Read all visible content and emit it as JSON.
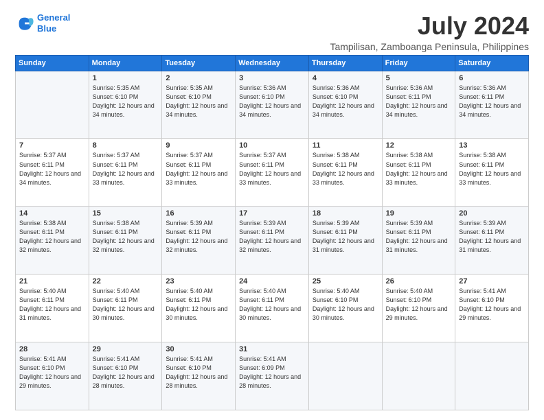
{
  "logo": {
    "line1": "General",
    "line2": "Blue"
  },
  "title": "July 2024",
  "location": "Tampilisan, Zamboanga Peninsula, Philippines",
  "days_of_week": [
    "Sunday",
    "Monday",
    "Tuesday",
    "Wednesday",
    "Thursday",
    "Friday",
    "Saturday"
  ],
  "weeks": [
    [
      {
        "day": "",
        "info": ""
      },
      {
        "day": "1",
        "info": "Sunrise: 5:35 AM\nSunset: 6:10 PM\nDaylight: 12 hours and 34 minutes."
      },
      {
        "day": "2",
        "info": "Sunrise: 5:35 AM\nSunset: 6:10 PM\nDaylight: 12 hours and 34 minutes."
      },
      {
        "day": "3",
        "info": "Sunrise: 5:36 AM\nSunset: 6:10 PM\nDaylight: 12 hours and 34 minutes."
      },
      {
        "day": "4",
        "info": "Sunrise: 5:36 AM\nSunset: 6:10 PM\nDaylight: 12 hours and 34 minutes."
      },
      {
        "day": "5",
        "info": "Sunrise: 5:36 AM\nSunset: 6:11 PM\nDaylight: 12 hours and 34 minutes."
      },
      {
        "day": "6",
        "info": "Sunrise: 5:36 AM\nSunset: 6:11 PM\nDaylight: 12 hours and 34 minutes."
      }
    ],
    [
      {
        "day": "7",
        "info": "Sunrise: 5:37 AM\nSunset: 6:11 PM\nDaylight: 12 hours and 34 minutes."
      },
      {
        "day": "8",
        "info": "Sunrise: 5:37 AM\nSunset: 6:11 PM\nDaylight: 12 hours and 33 minutes."
      },
      {
        "day": "9",
        "info": "Sunrise: 5:37 AM\nSunset: 6:11 PM\nDaylight: 12 hours and 33 minutes."
      },
      {
        "day": "10",
        "info": "Sunrise: 5:37 AM\nSunset: 6:11 PM\nDaylight: 12 hours and 33 minutes."
      },
      {
        "day": "11",
        "info": "Sunrise: 5:38 AM\nSunset: 6:11 PM\nDaylight: 12 hours and 33 minutes."
      },
      {
        "day": "12",
        "info": "Sunrise: 5:38 AM\nSunset: 6:11 PM\nDaylight: 12 hours and 33 minutes."
      },
      {
        "day": "13",
        "info": "Sunrise: 5:38 AM\nSunset: 6:11 PM\nDaylight: 12 hours and 33 minutes."
      }
    ],
    [
      {
        "day": "14",
        "info": "Sunrise: 5:38 AM\nSunset: 6:11 PM\nDaylight: 12 hours and 32 minutes."
      },
      {
        "day": "15",
        "info": "Sunrise: 5:38 AM\nSunset: 6:11 PM\nDaylight: 12 hours and 32 minutes."
      },
      {
        "day": "16",
        "info": "Sunrise: 5:39 AM\nSunset: 6:11 PM\nDaylight: 12 hours and 32 minutes."
      },
      {
        "day": "17",
        "info": "Sunrise: 5:39 AM\nSunset: 6:11 PM\nDaylight: 12 hours and 32 minutes."
      },
      {
        "day": "18",
        "info": "Sunrise: 5:39 AM\nSunset: 6:11 PM\nDaylight: 12 hours and 31 minutes."
      },
      {
        "day": "19",
        "info": "Sunrise: 5:39 AM\nSunset: 6:11 PM\nDaylight: 12 hours and 31 minutes."
      },
      {
        "day": "20",
        "info": "Sunrise: 5:39 AM\nSunset: 6:11 PM\nDaylight: 12 hours and 31 minutes."
      }
    ],
    [
      {
        "day": "21",
        "info": "Sunrise: 5:40 AM\nSunset: 6:11 PM\nDaylight: 12 hours and 31 minutes."
      },
      {
        "day": "22",
        "info": "Sunrise: 5:40 AM\nSunset: 6:11 PM\nDaylight: 12 hours and 30 minutes."
      },
      {
        "day": "23",
        "info": "Sunrise: 5:40 AM\nSunset: 6:11 PM\nDaylight: 12 hours and 30 minutes."
      },
      {
        "day": "24",
        "info": "Sunrise: 5:40 AM\nSunset: 6:11 PM\nDaylight: 12 hours and 30 minutes."
      },
      {
        "day": "25",
        "info": "Sunrise: 5:40 AM\nSunset: 6:10 PM\nDaylight: 12 hours and 30 minutes."
      },
      {
        "day": "26",
        "info": "Sunrise: 5:40 AM\nSunset: 6:10 PM\nDaylight: 12 hours and 29 minutes."
      },
      {
        "day": "27",
        "info": "Sunrise: 5:41 AM\nSunset: 6:10 PM\nDaylight: 12 hours and 29 minutes."
      }
    ],
    [
      {
        "day": "28",
        "info": "Sunrise: 5:41 AM\nSunset: 6:10 PM\nDaylight: 12 hours and 29 minutes."
      },
      {
        "day": "29",
        "info": "Sunrise: 5:41 AM\nSunset: 6:10 PM\nDaylight: 12 hours and 28 minutes."
      },
      {
        "day": "30",
        "info": "Sunrise: 5:41 AM\nSunset: 6:10 PM\nDaylight: 12 hours and 28 minutes."
      },
      {
        "day": "31",
        "info": "Sunrise: 5:41 AM\nSunset: 6:09 PM\nDaylight: 12 hours and 28 minutes."
      },
      {
        "day": "",
        "info": ""
      },
      {
        "day": "",
        "info": ""
      },
      {
        "day": "",
        "info": ""
      }
    ]
  ]
}
